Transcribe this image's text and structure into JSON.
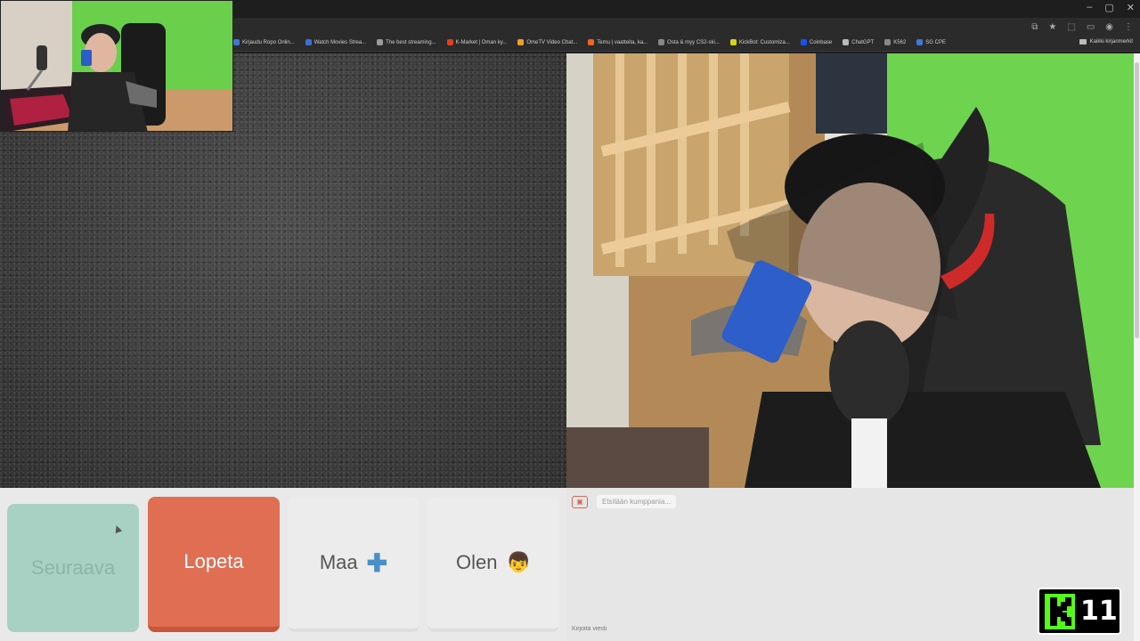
{
  "browser": {
    "window_controls": [
      "–",
      "▢",
      "✕"
    ],
    "bookmarks": [
      {
        "label": "Kirjaudu Ropo Onlin...",
        "color": "#3d7ad6"
      },
      {
        "label": "Watch Movies Strea...",
        "color": "#3a6fd8"
      },
      {
        "label": "The best streaming...",
        "color": "#9a9a9a"
      },
      {
        "label": "K-Market | Oman ky...",
        "color": "#e0401b"
      },
      {
        "label": "OmeTV Video Chat...",
        "color": "#f0a020"
      },
      {
        "label": "Temu | vaatteita, ka...",
        "color": "#f26322"
      },
      {
        "label": "Osta & myy CS2-ski...",
        "color": "#888888"
      },
      {
        "label": "KickBot: Customiza...",
        "color": "#d4d41c"
      },
      {
        "label": "Coinbase",
        "color": "#1652f0"
      },
      {
        "label": "ChatGPT",
        "color": "#bbbbbb"
      },
      {
        "label": "K562",
        "color": "#888888"
      },
      {
        "label": "SG CPE",
        "color": "#3d7ad6"
      }
    ],
    "all_bookmarks_label": "Kaikki kirjanmerkit"
  },
  "controls": {
    "next_label": "Seuraava",
    "stop_label": "Lopeta",
    "country_label": "Maa",
    "country_icon": "➕",
    "iam_label": "Olen",
    "iam_icon": "👦"
  },
  "chat": {
    "status_message": "Etsitään kumppania...",
    "input_placeholder": "Kirjoita viesti"
  },
  "stream_badge": {
    "number": "11",
    "color": "#53fc18"
  }
}
